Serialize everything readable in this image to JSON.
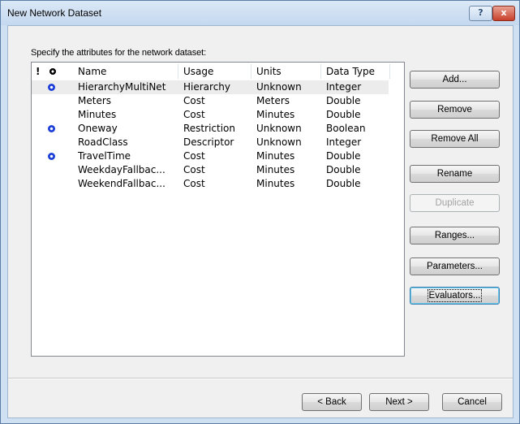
{
  "window": {
    "title": "New Network Dataset"
  },
  "titlebar": {
    "help_label": "?",
    "close_label": "x"
  },
  "instruction": "Specify the attributes for the network dataset:",
  "list": {
    "header": {
      "bang": "!",
      "name": "Name",
      "usage": "Usage",
      "units": "Units",
      "type": "Data Type"
    },
    "rows": [
      {
        "bang": "",
        "default_icon": true,
        "name": "HierarchyMultiNet",
        "usage": "Hierarchy",
        "units": "Unknown",
        "type": "Integer",
        "selected": true
      },
      {
        "bang": "",
        "default_icon": false,
        "name": "Meters",
        "usage": "Cost",
        "units": "Meters",
        "type": "Double"
      },
      {
        "bang": "",
        "default_icon": false,
        "name": "Minutes",
        "usage": "Cost",
        "units": "Minutes",
        "type": "Double"
      },
      {
        "bang": "",
        "default_icon": true,
        "name": "Oneway",
        "usage": "Restriction",
        "units": "Unknown",
        "type": "Boolean"
      },
      {
        "bang": "",
        "default_icon": false,
        "name": "RoadClass",
        "usage": "Descriptor",
        "units": "Unknown",
        "type": "Integer"
      },
      {
        "bang": "",
        "default_icon": true,
        "name": "TravelTime",
        "usage": "Cost",
        "units": "Minutes",
        "type": "Double"
      },
      {
        "bang": "",
        "default_icon": false,
        "name": "WeekdayFallbac...",
        "usage": "Cost",
        "units": "Minutes",
        "type": "Double"
      },
      {
        "bang": "",
        "default_icon": false,
        "name": "WeekendFallbac...",
        "usage": "Cost",
        "units": "Minutes",
        "type": "Double"
      }
    ]
  },
  "buttons": {
    "add": "Add...",
    "remove": "Remove",
    "remove_all": "Remove All",
    "rename": "Rename",
    "duplicate": "Duplicate",
    "ranges": "Ranges...",
    "parameters": "Parameters...",
    "evaluators": "Evaluators..."
  },
  "nav": {
    "back": "< Back",
    "next": "Next >",
    "cancel": "Cancel"
  },
  "colors": {
    "default_dot": "#1d3fd8",
    "title_bg": "#c4d8ef",
    "close": "#c8402a"
  }
}
